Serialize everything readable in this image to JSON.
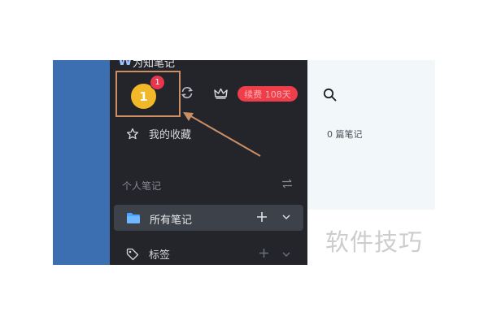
{
  "app": {
    "logo_glyph": "W",
    "name": "为知笔记"
  },
  "account": {
    "avatar_initial": "1",
    "notification_count": "1",
    "renew_label": "续费 108天"
  },
  "sidebar": {
    "favorites_label": "我的收藏",
    "section_title": "个人笔记",
    "all_notes_label": "所有笔记",
    "tags_label": "标签"
  },
  "notes_panel": {
    "count_text": "0 篇笔记"
  },
  "watermark": {
    "text": "软件技巧"
  },
  "colors": {
    "sidebar_bg": "#23252b",
    "accent_blue": "#3c6fb1",
    "badge_red": "#e8364e",
    "avatar_yellow": "#f1b92a",
    "annotation": "#cc8e63"
  },
  "icons": [
    "sync-icon",
    "crown-icon",
    "star-icon",
    "switch-icon",
    "folder-icon",
    "plus-icon",
    "chevron-down-icon",
    "tag-icon",
    "search-icon"
  ]
}
